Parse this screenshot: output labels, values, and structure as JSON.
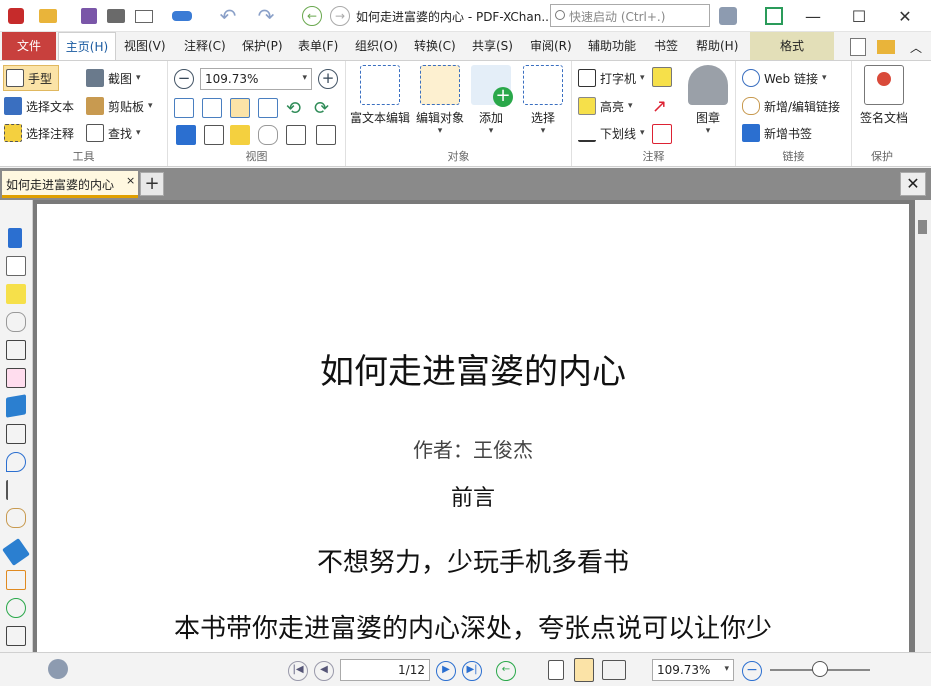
{
  "window": {
    "title": "如何走进富婆的内心 - PDF-XChan...",
    "quick_search_placeholder": "快速启动 (Ctrl+.)",
    "minimize": "—",
    "maximize": "☐",
    "close": "✕"
  },
  "menu": {
    "tabs": [
      "文件",
      "主页(H)",
      "视图(V)",
      "注释(C)",
      "保护(P)",
      "表单(F)",
      "组织(O)",
      "转换(C)",
      "共享(S)",
      "审阅(R)",
      "辅助功能",
      "书签",
      "帮助(H)",
      "格式"
    ]
  },
  "ribbon": {
    "tools": {
      "hand": "手型",
      "select_text": "选择文本",
      "select_annot": "选择注释",
      "snapshot": "截图",
      "clipboard": "剪贴板",
      "find": "查找",
      "label": "工具"
    },
    "view": {
      "zoom": "109.73%",
      "label": "视图"
    },
    "objects": {
      "rich_text": "富文本编辑",
      "edit_object": "编辑对象",
      "add": "添加",
      "select": "选择",
      "label": "对象"
    },
    "comments": {
      "typewriter": "打字机",
      "highlight": "高亮",
      "underline": "下划线",
      "stamp": "图章",
      "label": "注释"
    },
    "links": {
      "web_links": "Web 链接",
      "add_edit_link": "新增/编辑链接",
      "add_bookmark": "新增书签",
      "label": "链接"
    },
    "protect": {
      "sign": "签名文档",
      "label": "保护"
    }
  },
  "doctab": {
    "name": "如何走进富婆的内心",
    "close": "×",
    "new": "+",
    "close_all": "✕"
  },
  "document": {
    "title": "如何走进富婆的内心",
    "author": "作者：王俊杰",
    "preface": "前言",
    "slogan": "不想努力，少玩手机多看书",
    "body_line": "本书带你走进富婆的内心深处，夸张点说可以让你少"
  },
  "status": {
    "page": "1/12",
    "zoom": "109.73%"
  }
}
